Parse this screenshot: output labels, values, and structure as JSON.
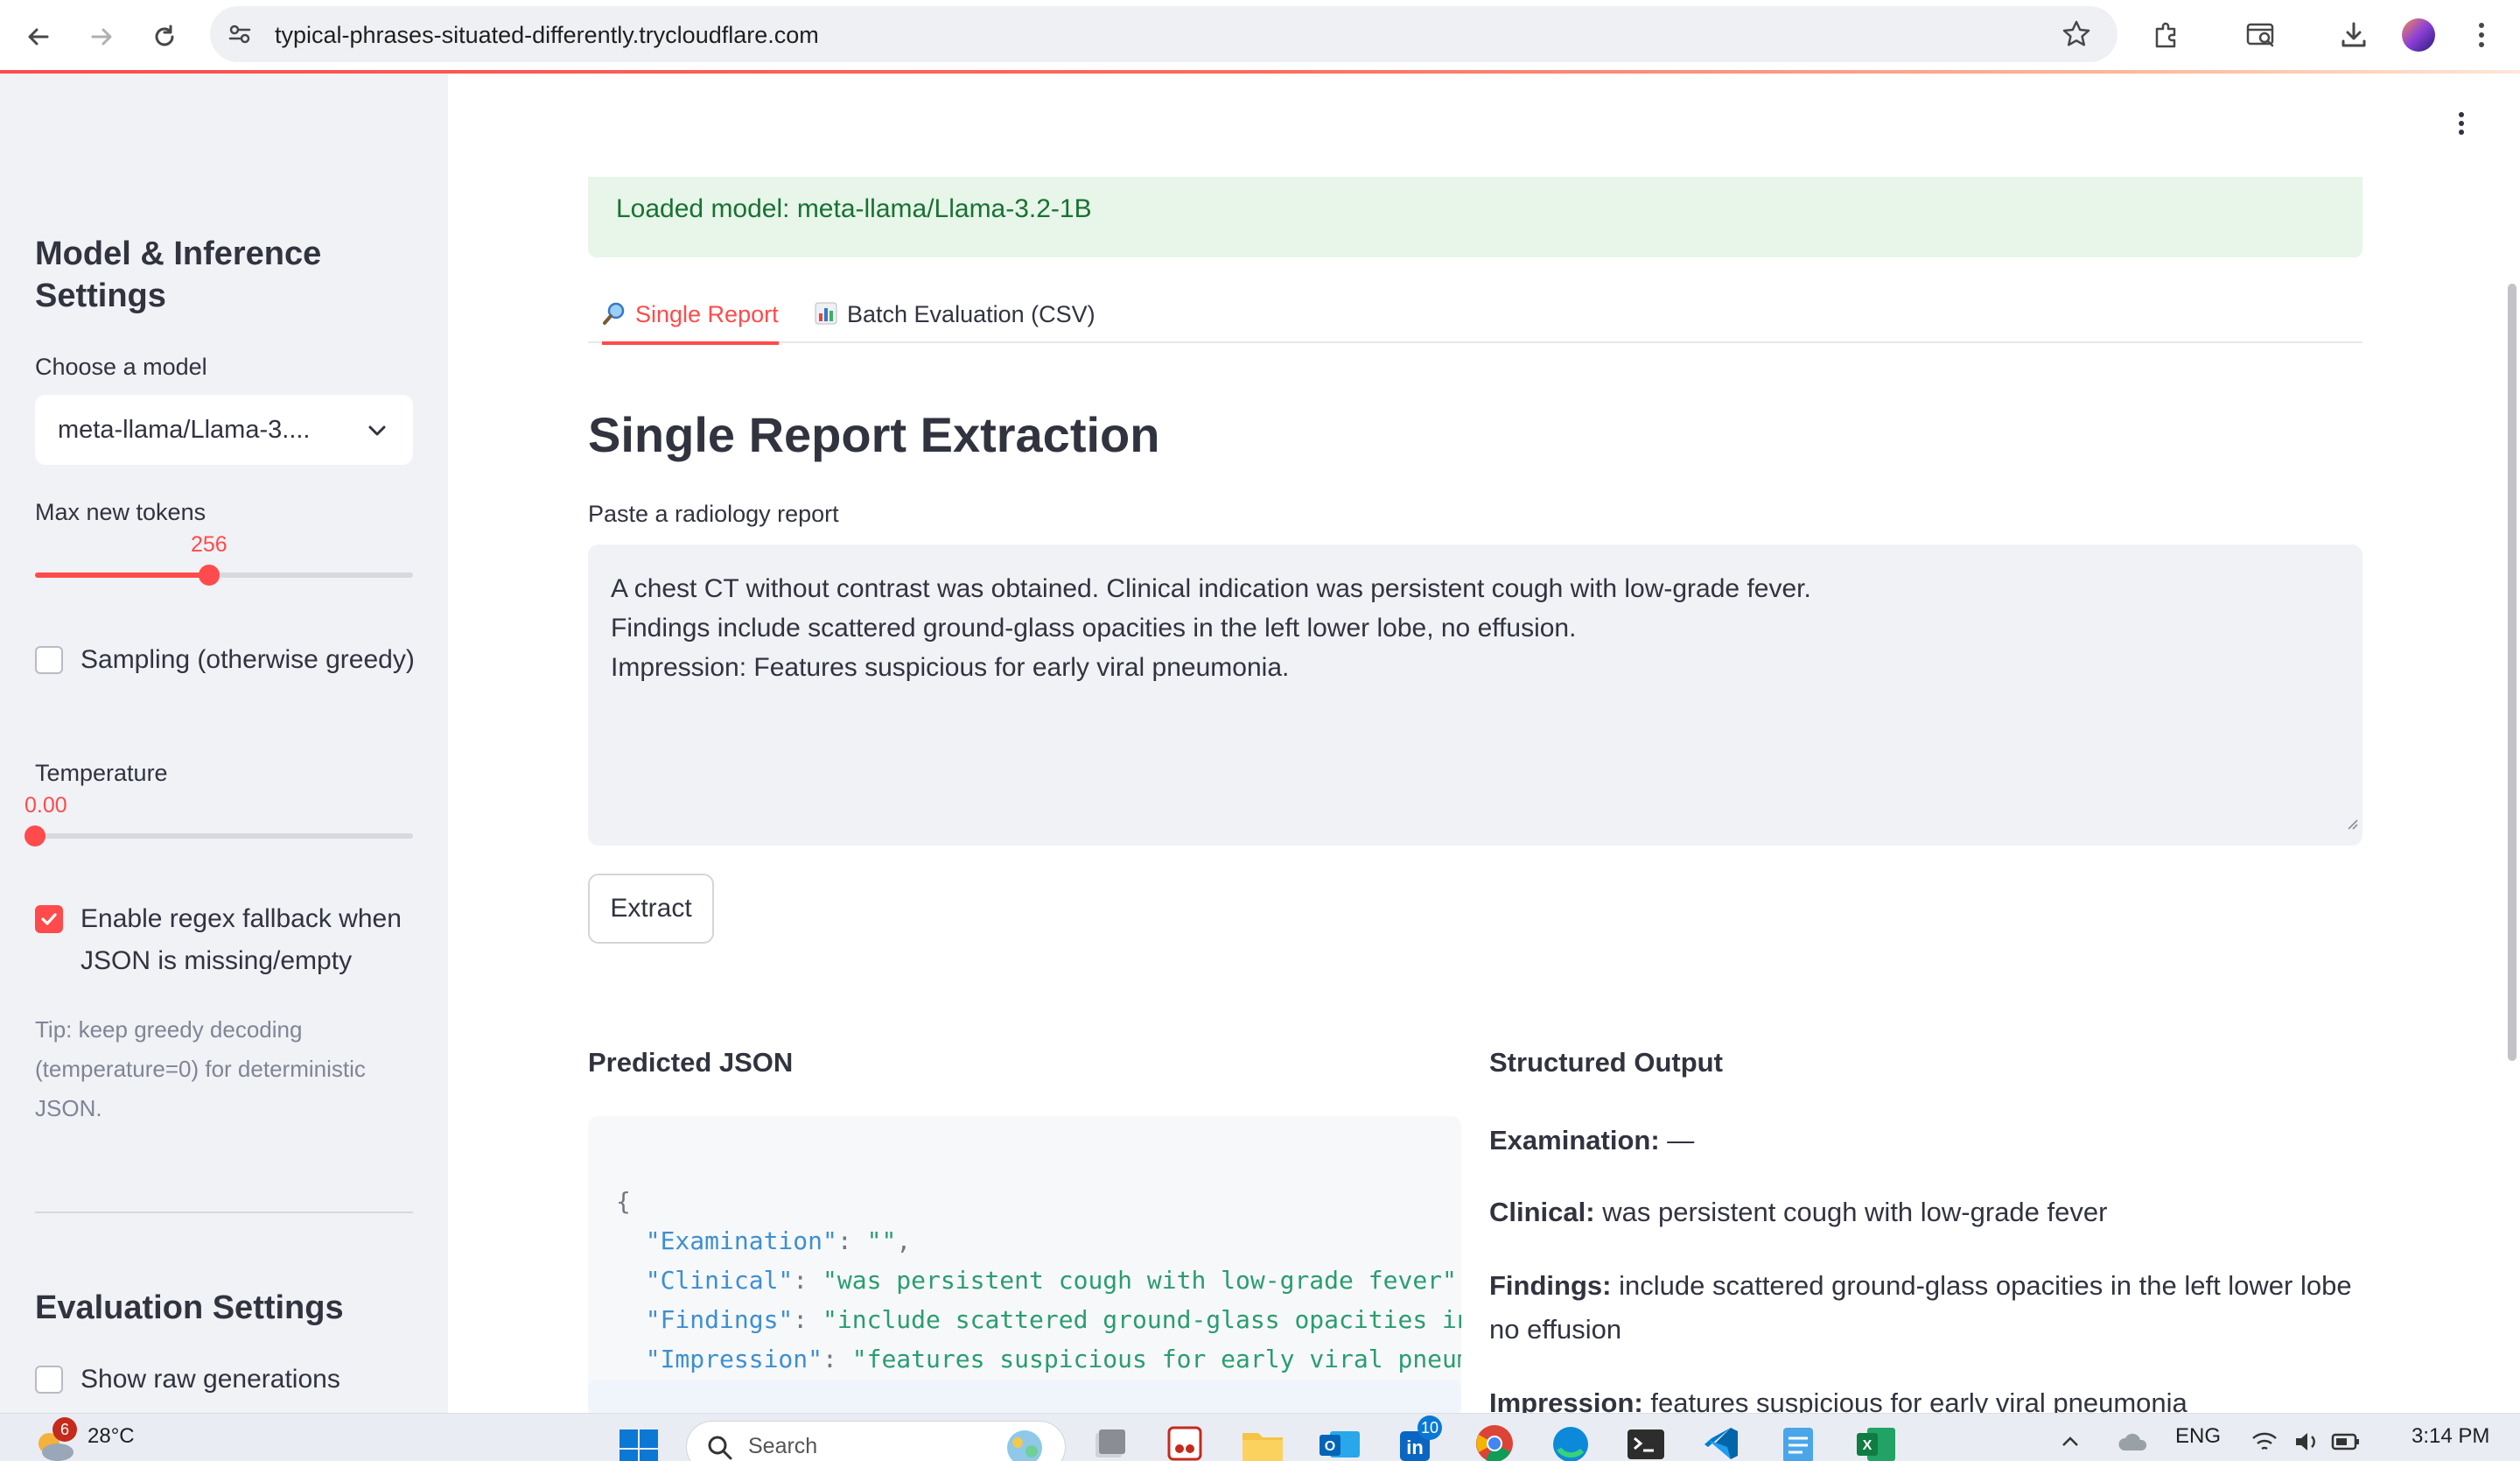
{
  "browser": {
    "url": "typical-phrases-situated-differently.trycloudflare.com"
  },
  "sidebar": {
    "model_section_title": "Model & Inference Settings",
    "model_select": {
      "label": "Choose a model",
      "value": "meta-llama/Llama-3...."
    },
    "max_tokens": {
      "label": "Max new tokens",
      "value": "256",
      "fraction": 0.46
    },
    "sampling": {
      "label": "Sampling (otherwise greedy)",
      "checked": false
    },
    "temperature": {
      "label": "Temperature",
      "value": "0.00",
      "fraction": 0.0
    },
    "regex_fallback": {
      "label": "Enable regex fallback when JSON is missing/empty",
      "checked": true
    },
    "tip": "Tip: keep greedy decoding (temperature=0) for deterministic JSON.",
    "eval_section_title": "Evaluation Settings",
    "show_raw": {
      "label": "Show raw generations",
      "checked": false
    }
  },
  "main": {
    "alert": "Loaded model: meta-llama/Llama-3.2-1B",
    "tabs": [
      {
        "label": "Single Report",
        "icon": "magnifier-icon",
        "active": true
      },
      {
        "label": "Batch Evaluation (CSV)",
        "icon": "bar-chart-icon",
        "active": false
      }
    ],
    "title": "Single Report Extraction",
    "textarea_label": "Paste a radiology report",
    "report_lines": [
      "A chest CT without contrast was obtained. Clinical indication was persistent cough with low-grade fever.",
      "Findings include scattered ground-glass opacities in the left lower lobe, no effusion.",
      "Impression: Features suspicious for early viral pneumonia."
    ],
    "extract_button": "Extract",
    "predicted_json_title": "Predicted JSON",
    "json": {
      "open": "{",
      "close": "}",
      "entries": [
        {
          "key": "\"Examination\"",
          "value": "\"\""
        },
        {
          "key": "\"Clinical\"",
          "value": "\"was persistent cough with low-grade fever\""
        },
        {
          "key": "\"Findings\"",
          "value": "\"include scattered ground-glass opacities in the left lower lobe no effusion\""
        },
        {
          "key": "\"Impression\"",
          "value": "\"features suspicious for early viral pneumonia\""
        }
      ]
    },
    "structured_output_title": "Structured Output",
    "structured": [
      {
        "label": "Examination:",
        "value": "—"
      },
      {
        "label": "Clinical:",
        "value": "was persistent cough with low-grade fever"
      },
      {
        "label": "Findings:",
        "value": "include scattered ground-glass opacities in the left lower lobe no effusion"
      },
      {
        "label": "Impression:",
        "value": "features suspicious for early viral pneumonia"
      }
    ]
  },
  "taskbar": {
    "temperature": "28°C",
    "weather_badge": "6",
    "search_placeholder": "Search",
    "linkedin_badge": "10",
    "language": "ENG",
    "time": "3:14 PM"
  },
  "colors": {
    "accent": "#ff4b4b",
    "success_bg": "#e8f5e9",
    "success_text": "#177233"
  }
}
